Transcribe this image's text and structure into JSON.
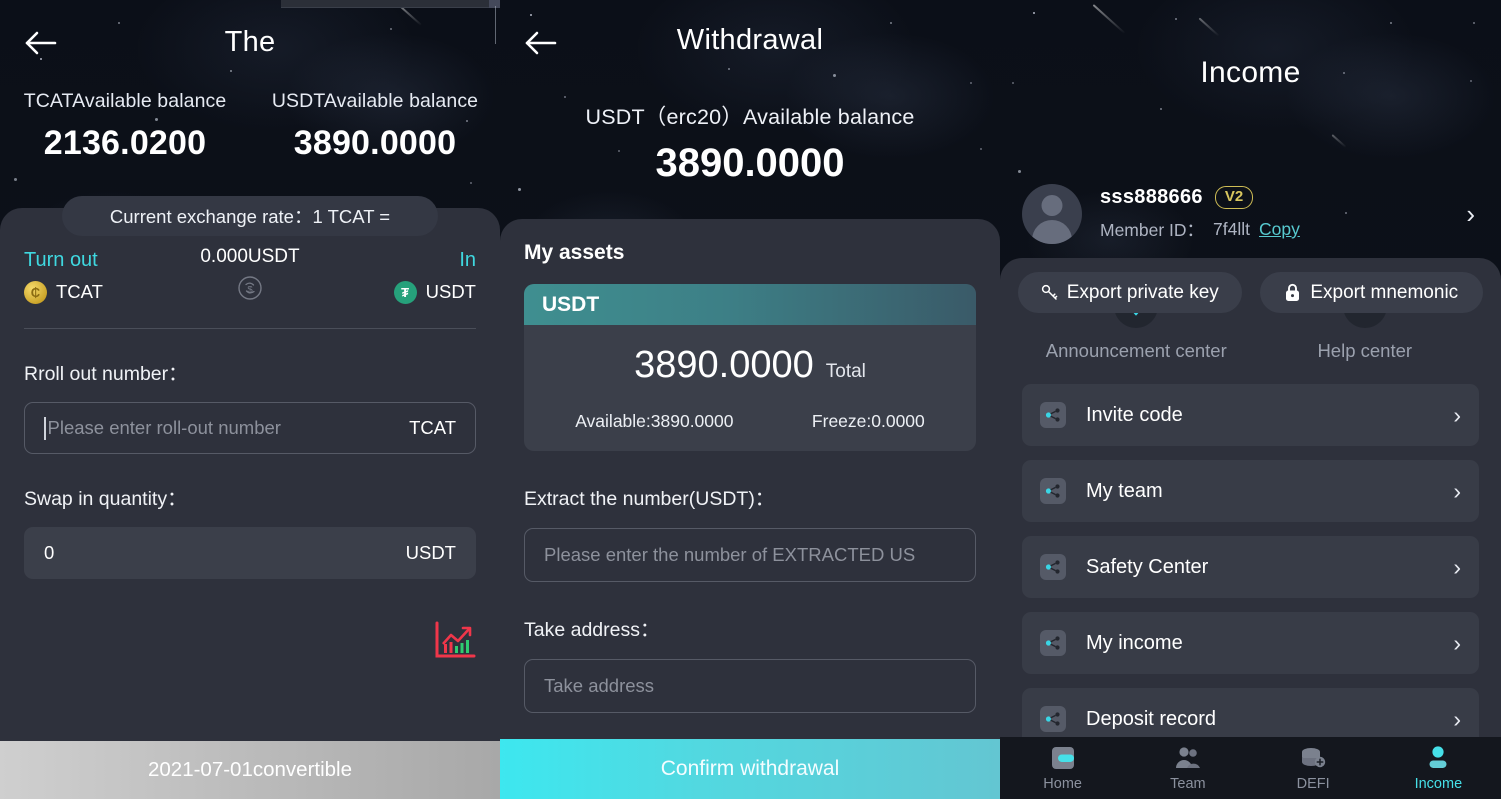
{
  "panel_swap": {
    "title": "The",
    "back_icon": "arrow-left-icon",
    "balances": [
      {
        "label": "TCATAvailable balance",
        "value": "2136.0200"
      },
      {
        "label": "USDTAvailable balance",
        "value": "3890.0000"
      }
    ],
    "exchange_rate": "Current exchange rate：1 TCAT =",
    "swap": {
      "from_label": "Turn out",
      "from_coin": "TCAT",
      "to_label": "In",
      "to_coin": "USDT",
      "middle_value": "0.000USDT",
      "swap_icon": "swap-circle-dollar-icon"
    },
    "rollout": {
      "label": "Rroll out number：",
      "placeholder": "Please enter roll-out number",
      "unit": "TCAT"
    },
    "swapin": {
      "label": "Swap in quantity：",
      "value": "0",
      "unit": "USDT"
    },
    "chart_icon": "candlestick-chart-icon",
    "footer_button": "2021-07-01convertible"
  },
  "panel_withdrawal": {
    "title": "Withdrawal",
    "back_icon": "arrow-left-icon",
    "balance_label": "USDT（erc20）Available balance",
    "balance_value": "3890.0000",
    "assets_title": "My assets",
    "asset_card": {
      "symbol": "USDT",
      "total_value": "3890.0000",
      "total_label": "Total",
      "available": "Available:3890.0000",
      "freeze": "Freeze:0.0000"
    },
    "extract": {
      "label": "Extract the number(USDT)：",
      "placeholder": "Please enter the number of EXTRACTED US"
    },
    "address": {
      "label": "Take address：",
      "placeholder": "Take address"
    },
    "confirm_button": "Confirm withdrawal"
  },
  "panel_income": {
    "title": "Income",
    "profile": {
      "avatar_icon": "user-avatar-icon",
      "name": "sss888666",
      "level_badge": "V2",
      "member_id_label": "Member ID：",
      "member_id": "7f4llt",
      "copy_label": "Copy",
      "chevron_icon": "chevron-right-icon"
    },
    "export_buttons": [
      {
        "label": "Export private key",
        "icon": "key-icon"
      },
      {
        "label": "Export mnemonic",
        "icon": "lock-icon"
      }
    ],
    "centers": [
      {
        "label": "Announcement center",
        "icon": "location-pin-icon"
      },
      {
        "label": "Help center",
        "icon": "info-icon"
      }
    ],
    "menu": [
      {
        "label": "Invite code",
        "icon": "share-nodes-icon"
      },
      {
        "label": "My team",
        "icon": "share-nodes-icon"
      },
      {
        "label": "Safety Center",
        "icon": "share-nodes-icon"
      },
      {
        "label": "My income",
        "icon": "share-nodes-icon"
      },
      {
        "label": "Deposit record",
        "icon": "share-nodes-icon"
      }
    ],
    "tabs": [
      {
        "label": "Home",
        "icon": "home-icon",
        "active": false
      },
      {
        "label": "Team",
        "icon": "team-icon",
        "active": false
      },
      {
        "label": "DEFI",
        "icon": "defi-coins-icon",
        "active": false
      },
      {
        "label": "Income",
        "icon": "person-icon",
        "active": true
      }
    ]
  },
  "colors": {
    "accent_teal": "#46e0e8",
    "sheet_bg": "#2e313c",
    "badge_gold": "#d8c65f",
    "usdt_green": "#26a17b",
    "chart_red": "#f0364a"
  }
}
